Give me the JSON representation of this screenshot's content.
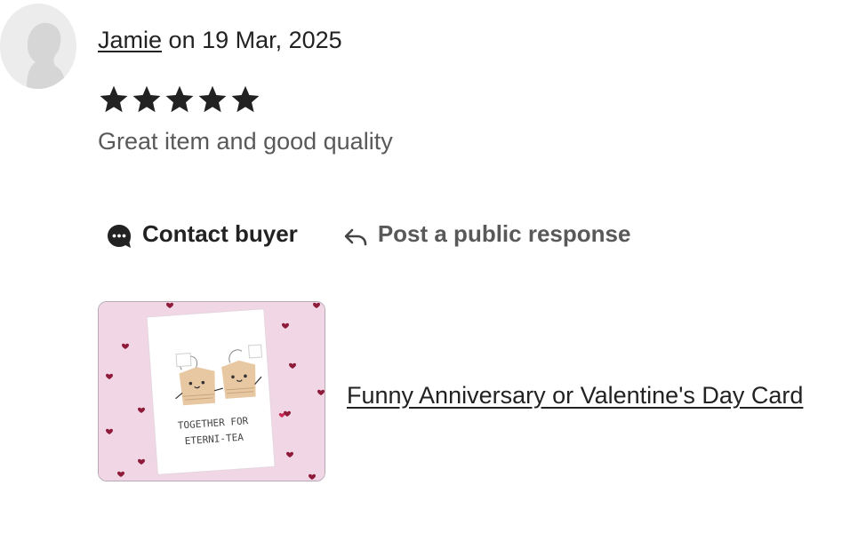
{
  "review": {
    "reviewer_name": "Jamie",
    "date_text": "on 19 Mar, 2025",
    "rating": 5,
    "rating_max": 5,
    "text": "Great item and good quality"
  },
  "actions": {
    "contact_label": "Contact buyer",
    "public_response_label": "Post a public response"
  },
  "listing": {
    "title": "Funny Anniversary or Valentine's Day Card",
    "card_text_line1": "TOGETHER FOR",
    "card_text_line2": "ETERNI-TEA"
  },
  "icons": {
    "contact": "speech-bubble-icon",
    "public_response": "reply-arrow-icon",
    "star": "star-icon"
  },
  "colors": {
    "text": "#222222",
    "muted": "#595959",
    "card_background": "#f1d7e6",
    "heart": "#8e1b3a"
  }
}
